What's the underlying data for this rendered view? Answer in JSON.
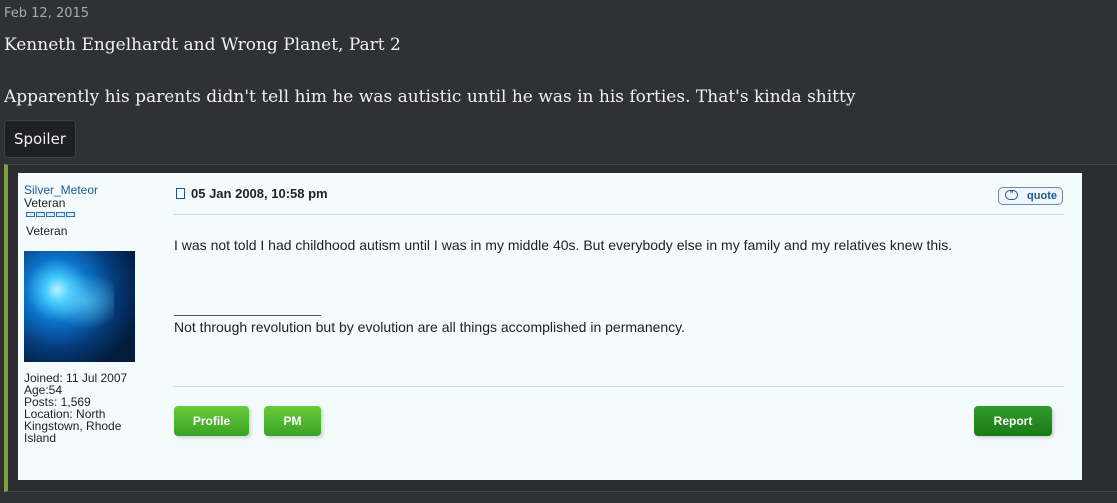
{
  "post": {
    "date": "Feb 12, 2015",
    "title": "Kenneth Engelhardt and Wrong Planet, Part 2",
    "body": "Apparently his parents didn't tell him he was autistic until he was in his forties. That's kinda shitty",
    "spoiler_label": "Spoiler"
  },
  "embed": {
    "username": "Silver_Meteor",
    "rank_title": "Veteran",
    "rank_label": "Veteran",
    "joined": "Joined: 11 Jul 2007",
    "age": "Age:54",
    "posts": "Posts: 1,569",
    "location_line1": "Location: North",
    "location_line2": "Kingstown, Rhode",
    "location_line3": "Island",
    "post_date": "05 Jan 2008, 10:58 pm",
    "quote_label": "quote",
    "text": "I was not told I had childhood autism until I was in my middle 40s. But everybody else in my family and my relatives knew this.",
    "signature": "Not through revolution but by evolution are all things accomplished in permanency.",
    "buttons": {
      "profile": "Profile",
      "pm": "PM",
      "report": "Report"
    }
  },
  "colors": {
    "accent_border": "#7aa33a",
    "page_bg": "#2f3136",
    "embed_bg": "#f3fbfd",
    "button_green": "#4fb82e"
  }
}
